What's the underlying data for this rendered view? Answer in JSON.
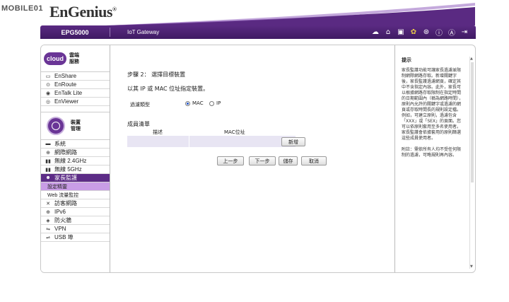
{
  "watermark": "MOBILE01",
  "brand": {
    "logo_text": "EnGenius",
    "reg": "®"
  },
  "topbar": {
    "model": "EPG5000",
    "title": "IoT Gateway",
    "icons": [
      "cloud-upload-icon",
      "home-icon",
      "device-icon",
      "gear-icon",
      "globe-icon",
      "info-icon",
      "account-icon",
      "logout-icon"
    ]
  },
  "sidebar": {
    "cloud": {
      "logo": "cloud",
      "label": "雲端服務"
    },
    "cloud_items": [
      {
        "label": "EnShare",
        "icon": "share-icon"
      },
      {
        "label": "EnRoute",
        "icon": "route-icon"
      },
      {
        "label": "EnTalk Lite",
        "icon": "talk-icon"
      },
      {
        "label": "EnViewer",
        "icon": "viewer-icon"
      }
    ],
    "device": {
      "label": "裝置管理"
    },
    "device_items": [
      {
        "label": "系統",
        "icon": "monitor-icon"
      },
      {
        "label": "網際網路",
        "icon": "globe-icon"
      },
      {
        "label": "無線 2.4GHz",
        "icon": "wireless-icon"
      },
      {
        "label": "無線 5GHz",
        "icon": "wireless-icon"
      },
      {
        "label": "家長監護",
        "icon": "parental-icon"
      }
    ],
    "sub_items": [
      {
        "label": "設定精靈"
      },
      {
        "label": "Web 流量監控"
      }
    ],
    "more_items": [
      {
        "label": "訪客網路",
        "icon": "guest-icon"
      },
      {
        "label": "IPv6",
        "icon": "ipv6-icon"
      },
      {
        "label": "防火牆",
        "icon": "firewall-icon"
      },
      {
        "label": "VPN",
        "icon": "vpn-icon"
      },
      {
        "label": "USB 埠",
        "icon": "usb-icon"
      }
    ]
  },
  "main": {
    "step": "步驟 2： 選擇目標裝置",
    "subtitle": "以其 IP 或 MAC 位址指定裝置。",
    "filter_label": "過濾類型",
    "radio_mac": "MAC",
    "radio_ip": "IP",
    "selected": "MAC",
    "list_title": "成員清單",
    "col_desc": "描述",
    "col_mac": "MAC位址",
    "add_button": "新增",
    "prev_button": "上一步",
    "next_button": "下一步",
    "save_button": "儲存",
    "cancel_button": "取消"
  },
  "hint": {
    "title": "提示",
    "text1": "家長監護功能可讓家長過濾並限制網際網路存取。新增關鍵字後，家長監護過濾網頁，確定其中不含指定內容。此外，家長可以根據網路存取限制在指定時間的日期範圍內（稱為網路時間），原則內允許的關鍵字或過濾的網頁或存取時間長的規則設定檔。例如，可建立原則，過濾包含「XXX」或「SEX」的頁面。您可以依原則套用至多名使用者。家長監護會依據套用的原則篩選這些成員使用者。",
    "text2": "附註：需依所有人均不受任何限制的過濾，可略規則再內容。"
  }
}
